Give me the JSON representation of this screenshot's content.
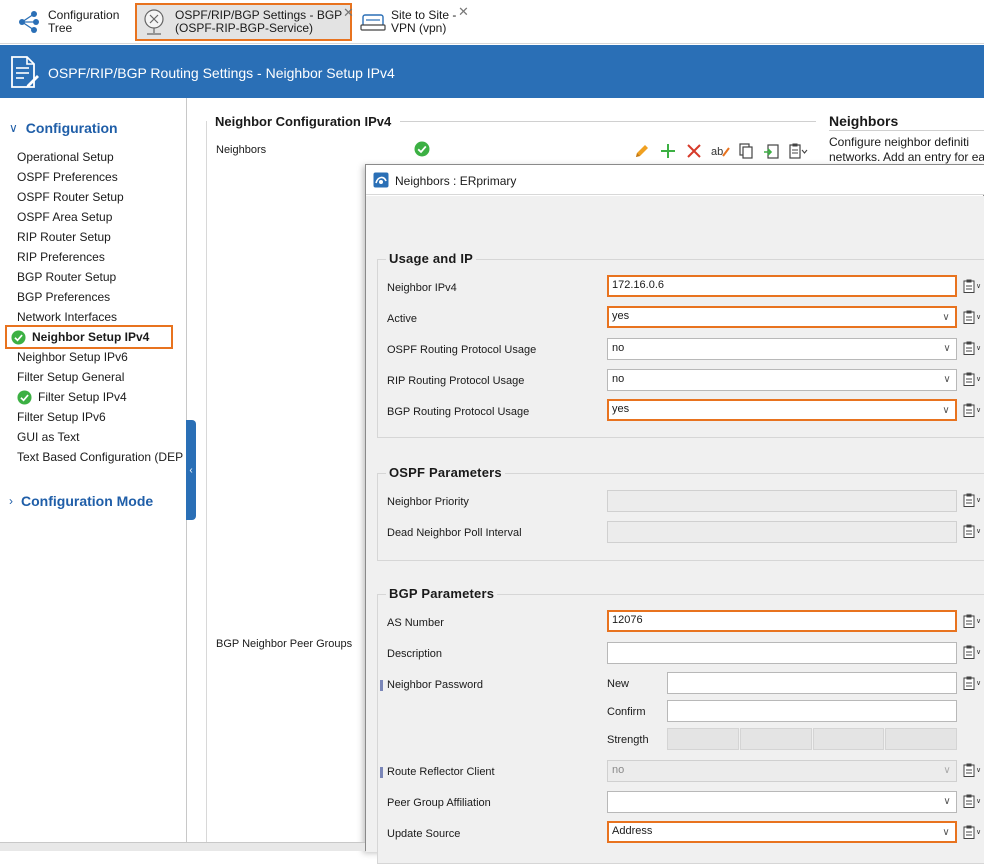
{
  "tabs": [
    {
      "line1": "Configuration",
      "line2": "Tree",
      "icon": "tree-icon"
    },
    {
      "line1": "OSPF/RIP/BGP Settings - BGP",
      "line2": "(OSPF-RIP-BGP-Service)",
      "icon": "router-icon",
      "close": "✕"
    },
    {
      "line1": "Site to Site -",
      "line2": "VPN (vpn)",
      "icon": "vpn-icon",
      "close": "✕"
    }
  ],
  "banner": {
    "title": "OSPF/RIP/BGP Routing Settings - Neighbor Setup IPv4"
  },
  "nav": {
    "section1": "Configuration",
    "section2": "Configuration Mode",
    "items": [
      "Operational Setup",
      "OSPF Preferences",
      "OSPF Router Setup",
      "OSPF Area Setup",
      "RIP Router Setup",
      "RIP Preferences",
      "BGP Router Setup",
      "BGP Preferences",
      "Network Interfaces",
      "Neighbor Setup IPv4",
      "Neighbor Setup IPv6",
      "Filter Setup General",
      "Filter Setup IPv4",
      "Filter Setup IPv6",
      "GUI as Text",
      "Text Based Configuration (DEP"
    ]
  },
  "middle": {
    "title": "Neighbor Configuration IPv4",
    "neighbors_label": "Neighbors",
    "peer_groups_label": "BGP Neighbor Peer Groups"
  },
  "help": {
    "title": "Neighbors",
    "line1": "Configure neighbor definiti",
    "line2": "networks. Add an entry for ea"
  },
  "dialog": {
    "title": "Neighbors : ERprimary",
    "usage": {
      "title": "Usage and IP",
      "neighbor_ipv4_label": "Neighbor IPv4",
      "neighbor_ipv4_value": "172.16.0.6",
      "active_label": "Active",
      "active_value": "yes",
      "ospf_label": "OSPF Routing Protocol Usage",
      "ospf_value": "no",
      "rip_label": "RIP Routing Protocol Usage",
      "rip_value": "no",
      "bgp_label": "BGP Routing Protocol Usage",
      "bgp_value": "yes"
    },
    "ospf": {
      "title": "OSPF Parameters",
      "priority_label": "Neighbor Priority",
      "dead_label": "Dead Neighbor Poll Interval"
    },
    "bgp": {
      "title": "BGP Parameters",
      "as_label": "AS Number",
      "as_value": "12076",
      "desc_label": "Description",
      "pw_label": "Neighbor Password",
      "pw_new": "New",
      "pw_confirm": "Confirm",
      "pw_strength": "Strength",
      "rr_label": "Route Reflector Client",
      "rr_value": "no",
      "peer_label": "Peer Group Affiliation",
      "update_label": "Update Source",
      "update_value": "Address"
    }
  },
  "colors": {
    "accent": "#e8731f",
    "banner": "#2a6fb6",
    "nav_heading": "#1f5ea8",
    "ok_green": "#3cb043"
  }
}
